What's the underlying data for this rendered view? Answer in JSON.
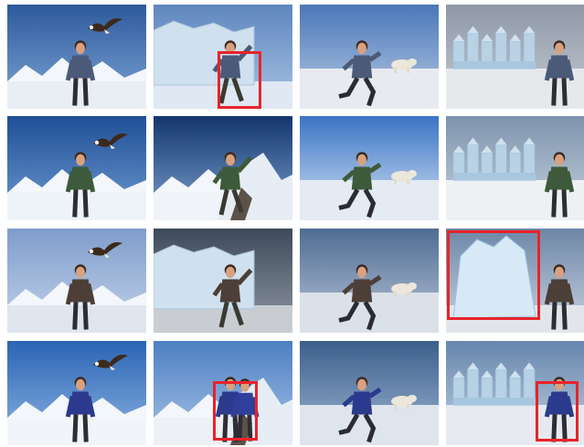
{
  "highlight_color": "#e8232a",
  "tiles": [
    {
      "row": 1,
      "col": 1,
      "scene": "eagle-snowy-peaks",
      "sky": [
        "#2d5a9c",
        "#7fa6d6"
      ],
      "ground": "#e9eef5",
      "subject": "man-standing",
      "extra": "eagle-icon",
      "highlighted": false
    },
    {
      "row": 1,
      "col": 2,
      "scene": "ice-cliff",
      "sky": [
        "#5f86bf",
        "#a8c4e3"
      ],
      "ground": "#dfe8f3",
      "subject": "man-climbing",
      "extra": "ice-cliff",
      "highlighted": true
    },
    {
      "row": 1,
      "col": 3,
      "scene": "frozen-harbor",
      "sky": [
        "#4a77b7",
        "#b9cde6"
      ],
      "ground": "#e7ebf0",
      "subject": "man-running",
      "extra": "polar-bear-icon",
      "highlighted": false
    },
    {
      "row": 1,
      "col": 4,
      "scene": "ice-castle",
      "sky": [
        "#8e98a6",
        "#c5ccd4"
      ],
      "ground": "#e6e9ec",
      "subject": "man-waving",
      "extra": "ice-castle",
      "highlighted": false
    },
    {
      "row": 2,
      "col": 1,
      "scene": "eagle-snow-ridge",
      "sky": [
        "#1f4f96",
        "#6f9bd3"
      ],
      "ground": "#eef3f8",
      "subject": "man-hiking",
      "extra": "eagle-icon",
      "highlighted": false
    },
    {
      "row": 2,
      "col": 2,
      "scene": "mountain-summit",
      "sky": [
        "#14366e",
        "#7da3d0"
      ],
      "ground": "#f0f3f7",
      "subject": "man-climbing",
      "extra": "rock-ridge",
      "highlighted": false
    },
    {
      "row": 2,
      "col": 3,
      "scene": "polar-plain-sun",
      "sky": [
        "#3a73c4",
        "#d6e5f6"
      ],
      "ground": "#e4ebf3",
      "subject": "man-running",
      "extra": "polar-bear-icon",
      "highlighted": false
    },
    {
      "row": 2,
      "col": 4,
      "scene": "ice-castle-cloudy",
      "sky": [
        "#7d93ad",
        "#c7d3df"
      ],
      "ground": "#eef1f4",
      "subject": "man-standing",
      "extra": "ice-castle",
      "highlighted": false
    },
    {
      "row": 3,
      "col": 1,
      "scene": "eagle-glacier",
      "sky": [
        "#7f9ccb",
        "#c3d4ea"
      ],
      "ground": "#dfe6ef",
      "subject": "man-hiking",
      "extra": "eagle-icon",
      "highlighted": false
    },
    {
      "row": 3,
      "col": 2,
      "scene": "glacier-wall",
      "sky": [
        "#3e4a5a",
        "#8f98a3"
      ],
      "ground": "#c9cdd2",
      "subject": "man-climbing",
      "extra": "ice-cliff",
      "highlighted": false
    },
    {
      "row": 3,
      "col": 3,
      "scene": "polar-bear-plain",
      "sky": [
        "#4f6c93",
        "#b7c6d9"
      ],
      "ground": "#dbe1e8",
      "subject": "man-running",
      "extra": "polar-bear-icon",
      "highlighted": false
    },
    {
      "row": 3,
      "col": 4,
      "scene": "ice-sculpture",
      "sky": [
        "#6d86a6",
        "#c9d4e1"
      ],
      "ground": "#e2e6eb",
      "subject": "man-standing",
      "extra": "ice-sculpture",
      "highlighted": true
    },
    {
      "row": 4,
      "col": 1,
      "scene": "eagle-alps",
      "sky": [
        "#2a64b5",
        "#8db4e2"
      ],
      "ground": "#f1f4f8",
      "subject": "man-hiking",
      "extra": "eagle-icon",
      "highlighted": false
    },
    {
      "row": 4,
      "col": 2,
      "scene": "snow-mountain-pair",
      "sky": [
        "#4d7fc2",
        "#a8c4e6"
      ],
      "ground": "#edf1f6",
      "subject": "two-people",
      "extra": "rock-ridge",
      "highlighted": true
    },
    {
      "row": 4,
      "col": 3,
      "scene": "polar-bear-dusk",
      "sky": [
        "#3b5f8c",
        "#9fb6d2"
      ],
      "ground": "#dfe5ec",
      "subject": "man-running",
      "extra": "polar-bear-icon",
      "highlighted": false
    },
    {
      "row": 4,
      "col": 4,
      "scene": "ice-castle-blue",
      "sky": [
        "#6686ad",
        "#c2d0e1"
      ],
      "ground": "#e6eaf0",
      "subject": "man-standing",
      "extra": "ice-castle",
      "highlighted": true
    }
  ]
}
